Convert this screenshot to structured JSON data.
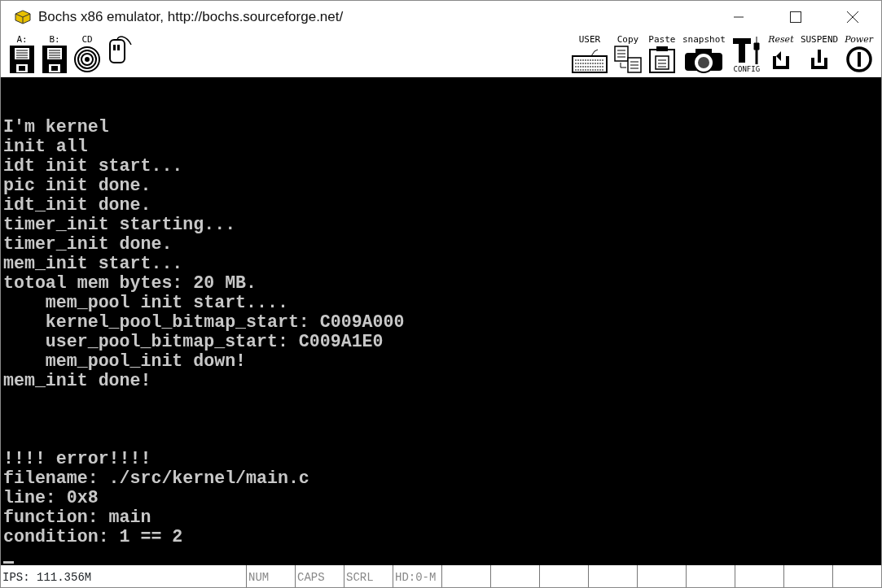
{
  "window": {
    "title": "Bochs x86 emulator, http://bochs.sourceforge.net/"
  },
  "toolbar": {
    "left": [
      {
        "label": "A:",
        "kind": "floppy"
      },
      {
        "label": "B:",
        "kind": "floppy"
      },
      {
        "label": "CD",
        "kind": "cdrom"
      },
      {
        "kind": "mouse"
      }
    ],
    "right": [
      {
        "label": "USER",
        "kind": "keyboard"
      },
      {
        "label": "Copy",
        "kind": "copy"
      },
      {
        "label": "Paste",
        "kind": "paste"
      },
      {
        "label": "snapshot",
        "kind": "camera"
      },
      {
        "label": "CONFIG",
        "kind": "config"
      },
      {
        "label": "Reset",
        "kind": "reset"
      },
      {
        "label": "SUSPEND",
        "kind": "suspend"
      },
      {
        "label": "Power",
        "kind": "power"
      }
    ]
  },
  "console": {
    "blocks": [
      [
        "I'm kernel",
        "init all",
        "idt init start...",
        "pic init done.",
        "idt_init done.",
        "timer_init starting...",
        "timer_init done.",
        "mem_init start...",
        "totoal mem bytes: 20 MB.",
        "    mem_pool init start....",
        "    kernel_pool_bitmap_start: C009A000",
        "    user_pool_bitmap_start: C009A1E0",
        "    mem_pool_init down!",
        "mem_init done!"
      ],
      [
        "!!!! error!!!!",
        "filename: ./src/kernel/main.c",
        "line: 0x8",
        "function: main",
        "condition: 1 == 2"
      ]
    ],
    "cursor": true
  },
  "status_bar": {
    "ips": "IPS: 111.356M",
    "indicators": [
      {
        "label": "NUM",
        "on": false
      },
      {
        "label": "CAPS",
        "on": false
      },
      {
        "label": "SCRL",
        "on": false
      },
      {
        "label": "HD:0-M",
        "on": false
      }
    ]
  }
}
